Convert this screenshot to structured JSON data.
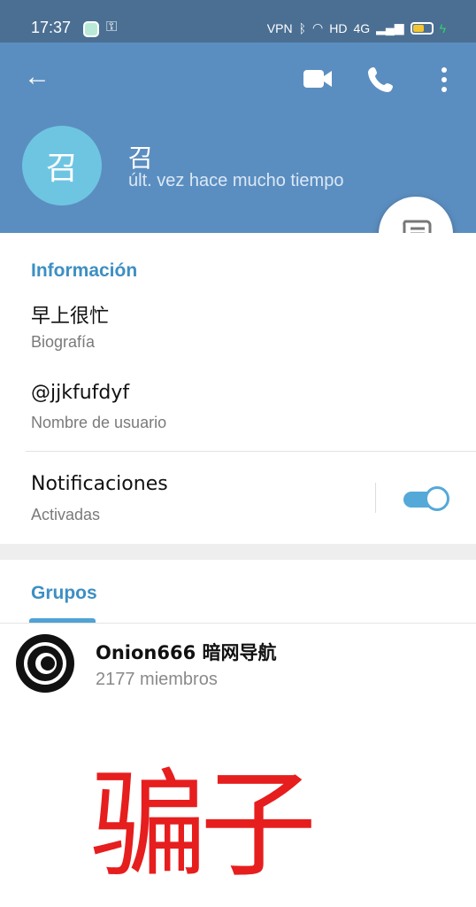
{
  "status_bar": {
    "time": "17:37",
    "right_text": "HD",
    "network": "4G",
    "icons": [
      "app-notification-icon",
      "key-icon",
      "vpn-icon",
      "bluetooth-icon",
      "headphones-icon",
      "hd-icon",
      "signal-icon",
      "battery-icon",
      "charging-icon"
    ]
  },
  "header": {
    "actions": [
      "back-arrow-icon",
      "video-call-icon",
      "phone-call-icon",
      "more-options-icon"
    ]
  },
  "profile": {
    "avatar_text": "召",
    "name": "召",
    "status": "últ. vez hace mucho tiempo"
  },
  "info": {
    "title": "Información",
    "bio_value": "早上很忙",
    "bio_label": "Biografía",
    "username_value": "@jjkfufdyf",
    "username_label": "Nombre de usuario",
    "notifications_value": "Notificaciones",
    "notifications_label": "Activadas",
    "notifications_enabled": true
  },
  "groups": {
    "title": "Grupos",
    "items": [
      {
        "name": "Onion666 暗网导航",
        "members": "2177 miembros"
      }
    ]
  },
  "overlay_text": "骗子",
  "colors": {
    "header": "#5b8ec0",
    "status_bar": "#4b6f93",
    "accent": "#3d8fc3",
    "toggle": "#55a9d8",
    "avatar": "#6ec5e2",
    "overlay": "#e61e1e"
  }
}
